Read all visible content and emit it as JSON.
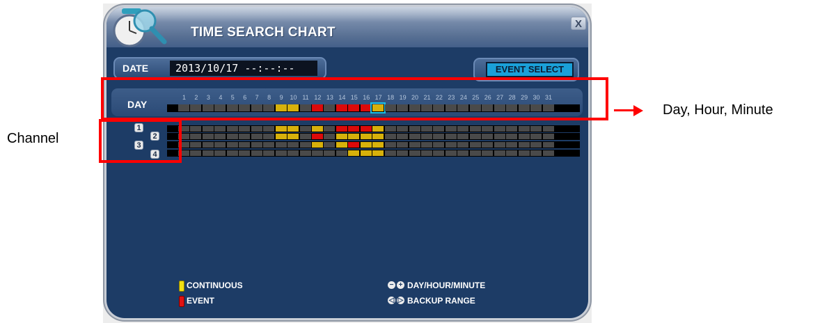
{
  "window": {
    "title": "TIME SEARCH CHART",
    "close": "X"
  },
  "date": {
    "label": "DATE",
    "value": "2013/10/17 --:--:--"
  },
  "event_select": {
    "label": "EVENT SELECT"
  },
  "day": {
    "label": "DAY",
    "numbers": [
      "1",
      "2",
      "3",
      "4",
      "5",
      "6",
      "7",
      "8",
      "9",
      "10",
      "11",
      "12",
      "13",
      "14",
      "15",
      "16",
      "17",
      "18",
      "19",
      "20",
      "21",
      "22",
      "23",
      "24",
      "25",
      "26",
      "27",
      "28",
      "29",
      "30",
      "31"
    ],
    "cells": [
      "n",
      "n",
      "n",
      "n",
      "n",
      "n",
      "n",
      "n",
      "y",
      "y",
      "n",
      "r",
      "n",
      "r",
      "r",
      "r",
      "s",
      "n",
      "n",
      "n",
      "n",
      "n",
      "n",
      "n",
      "n",
      "n",
      "n",
      "n",
      "n",
      "n",
      "n"
    ]
  },
  "channels": [
    {
      "label": "1",
      "cells": [
        "n",
        "n",
        "n",
        "n",
        "n",
        "n",
        "n",
        "n",
        "y",
        "y",
        "n",
        "y",
        "n",
        "r",
        "r",
        "r",
        "y",
        "n",
        "n",
        "n",
        "n",
        "n",
        "n",
        "n",
        "n",
        "n",
        "n",
        "n",
        "n",
        "n",
        "n"
      ]
    },
    {
      "label": "2",
      "cells": [
        "n",
        "n",
        "n",
        "n",
        "n",
        "n",
        "n",
        "n",
        "y",
        "y",
        "n",
        "r",
        "n",
        "y",
        "y",
        "y",
        "y",
        "n",
        "n",
        "n",
        "n",
        "n",
        "n",
        "n",
        "n",
        "n",
        "n",
        "n",
        "n",
        "n",
        "n"
      ]
    },
    {
      "label": "3",
      "cells": [
        "n",
        "n",
        "n",
        "n",
        "n",
        "n",
        "n",
        "n",
        "n",
        "n",
        "n",
        "y",
        "n",
        "y",
        "r",
        "y",
        "y",
        "n",
        "n",
        "n",
        "n",
        "n",
        "n",
        "n",
        "n",
        "n",
        "n",
        "n",
        "n",
        "n",
        "n"
      ]
    },
    {
      "label": "4",
      "cells": [
        "n",
        "n",
        "n",
        "n",
        "n",
        "n",
        "n",
        "n",
        "n",
        "n",
        "n",
        "n",
        "n",
        "n",
        "y",
        "y",
        "y",
        "n",
        "n",
        "n",
        "n",
        "n",
        "n",
        "n",
        "n",
        "n",
        "n",
        "n",
        "n",
        "n",
        "n"
      ]
    }
  ],
  "legend": {
    "continuous": "CONTINUOUS",
    "event": "EVENT",
    "nav": "DAY/HOUR/MINUTE",
    "backup": "BACKUP RANGE",
    "colors": {
      "continuous": "#d7b10b",
      "event": "#dc0a0a",
      "selected": "#19c0e6",
      "empty": "#4a4a4a"
    }
  },
  "annotations": {
    "right": "Day, Hour, Minute",
    "left": "Channel",
    "color": "#ff0000"
  }
}
